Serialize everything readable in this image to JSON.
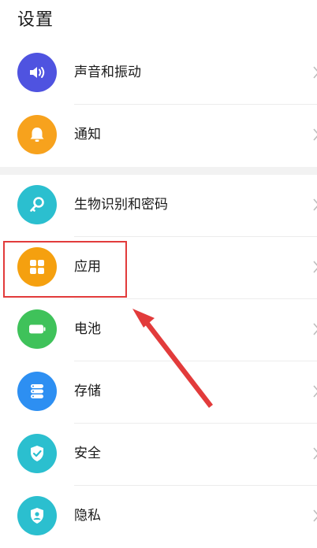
{
  "header": {
    "title": "设置"
  },
  "colors": {
    "sound": "#4f53e0",
    "notify": "#f7a21d",
    "biometric": "#2bbfcf",
    "apps": "#f5a00f",
    "battery": "#3fc25a",
    "storage": "#2d8ff2",
    "security": "#2bbfcf",
    "privacy": "#2bbfcf",
    "highlight": "#e23b3b"
  },
  "group_a": {
    "items": [
      {
        "label": "声音和振动",
        "icon": "speaker-icon"
      },
      {
        "label": "通知",
        "icon": "bell-icon"
      }
    ]
  },
  "group_b": {
    "items": [
      {
        "label": "生物识别和密码",
        "icon": "key-icon"
      },
      {
        "label": "应用",
        "icon": "apps-grid-icon"
      },
      {
        "label": "电池",
        "icon": "battery-icon"
      },
      {
        "label": "存储",
        "icon": "storage-icon"
      },
      {
        "label": "安全",
        "icon": "shield-check-icon"
      },
      {
        "label": "隐私",
        "icon": "privacy-icon"
      }
    ]
  }
}
